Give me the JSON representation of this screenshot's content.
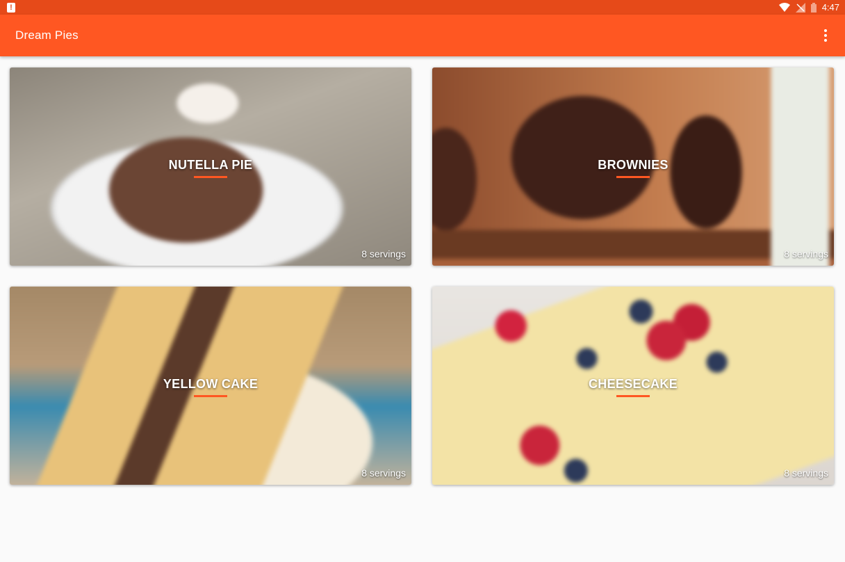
{
  "status_bar": {
    "time": "4:47",
    "icons": [
      "alert-icon",
      "wifi-icon",
      "no-signal-icon",
      "battery-icon"
    ]
  },
  "app_bar": {
    "title": "Dream Pies",
    "overflow_icon": "more-vert-icon"
  },
  "colors": {
    "status_bar": "#e64a19",
    "app_bar": "#ff5722",
    "accent_underline": "#ff5722",
    "background": "#fafafa"
  },
  "recipes": [
    {
      "title": "NUTELLA PIE",
      "servings": "8 servings"
    },
    {
      "title": "BROWNIES",
      "servings": "8 servings"
    },
    {
      "title": "YELLOW CAKE",
      "servings": "8 servings"
    },
    {
      "title": "CHEESECAKE",
      "servings": "8 servings"
    }
  ]
}
